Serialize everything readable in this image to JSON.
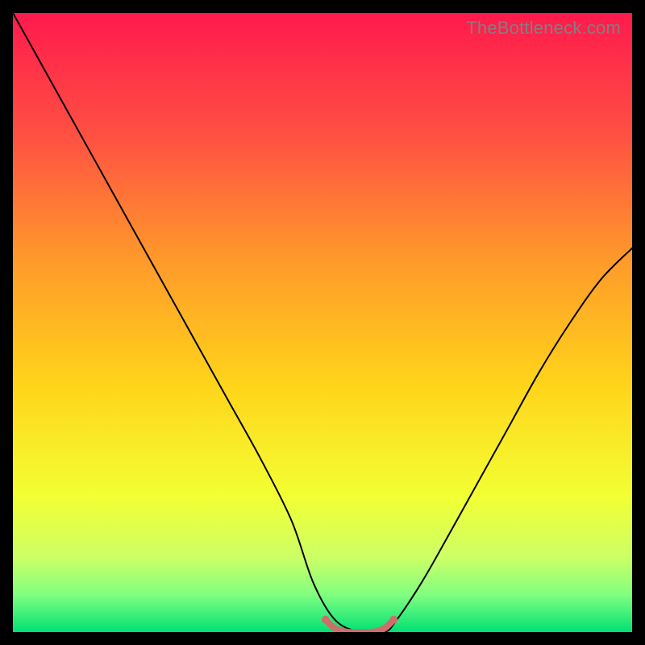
{
  "watermark": "TheBottleneck.com",
  "chart_data": {
    "type": "line",
    "title": "",
    "xlabel": "",
    "ylabel": "",
    "xlim": [
      0,
      100
    ],
    "ylim": [
      0,
      100
    ],
    "background_gradient": {
      "type": "vertical",
      "stops": [
        {
          "offset": 0.0,
          "color": "#ff1a4d"
        },
        {
          "offset": 0.2,
          "color": "#ff5142"
        },
        {
          "offset": 0.4,
          "color": "#ff9a2a"
        },
        {
          "offset": 0.6,
          "color": "#ffd41a"
        },
        {
          "offset": 0.78,
          "color": "#f3ff33"
        },
        {
          "offset": 0.88,
          "color": "#ccff66"
        },
        {
          "offset": 0.94,
          "color": "#80ff80"
        },
        {
          "offset": 1.0,
          "color": "#00e074"
        }
      ]
    },
    "series": [
      {
        "name": "bottleneck-curve",
        "color": "#000000",
        "width": 2,
        "x": [
          0.0,
          5,
          10,
          15,
          20,
          25,
          30,
          35,
          40,
          45,
          48.5,
          52,
          56,
          60,
          62,
          66,
          70,
          75,
          80,
          85,
          90,
          95,
          100
        ],
        "y": [
          100,
          91,
          82,
          73,
          64,
          55,
          46,
          37,
          28,
          18,
          8,
          2,
          0,
          0,
          2,
          8,
          15,
          24,
          33,
          42,
          50,
          57,
          62
        ]
      },
      {
        "name": "bottleneck-floor",
        "color": "#cc6f6a",
        "width": 8,
        "x": [
          50.5,
          52,
          54,
          56,
          58,
          60,
          61.5
        ],
        "y": [
          2.0,
          0.6,
          0.0,
          0.0,
          0.0,
          0.6,
          2.0
        ]
      }
    ],
    "floor_endpoints": {
      "color": "#cc6f6a",
      "radius": 5.0,
      "points": [
        {
          "x": 50.5,
          "y": 2.0
        },
        {
          "x": 61.5,
          "y": 2.0
        }
      ]
    }
  }
}
